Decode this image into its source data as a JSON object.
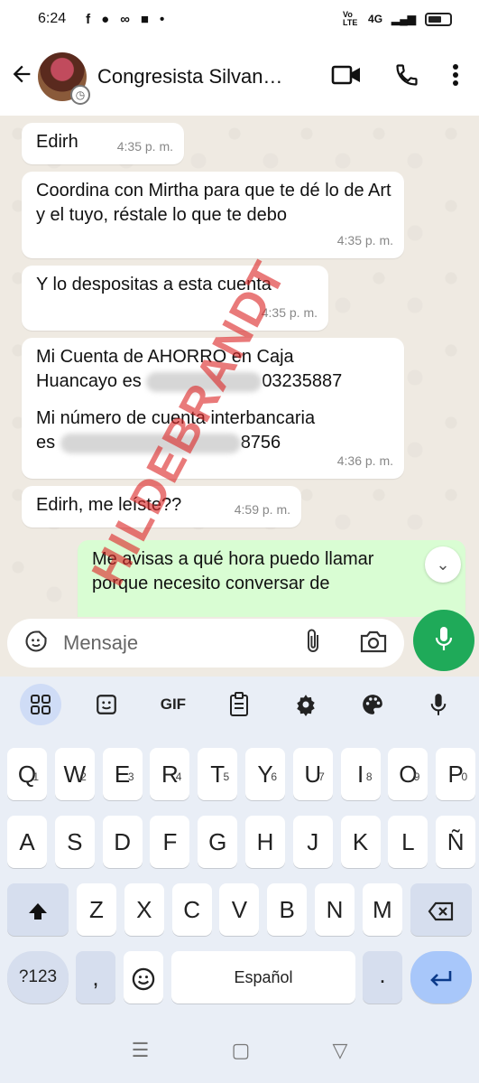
{
  "status_bar": {
    "time": "6:24",
    "network": "4G",
    "volte": "Vo LTE"
  },
  "header": {
    "contact_name": "Congresista Silvan…"
  },
  "messages": [
    {
      "text": "Edirh",
      "time": "4:35 p. m."
    },
    {
      "text": "Coordina con Mirtha para que te dé lo de Art y el tuyo, réstale lo que te debo",
      "time": "4:35 p. m."
    },
    {
      "text": "Y lo despositas a esta cuenta",
      "time": "4:35 p. m."
    },
    {
      "line1": "Mi Cuenta de AHORRO en Caja",
      "line2_start": "Huancayo es",
      "line2_end": "03235887",
      "line3": "Mi número de cuenta interbancaria",
      "line4_start": "es",
      "line4_end": "8756",
      "time": "4:36 p. m."
    },
    {
      "text": "Edirh, me leíste??",
      "time": "4:59 p. m."
    },
    {
      "line1": "Me avisas a qué hora puedo llamar",
      "line2": "porque necesito conversar de"
    }
  ],
  "composer": {
    "placeholder": "Mensaje"
  },
  "keyboard": {
    "toolbar": [
      "grid-icon",
      "sticker-icon",
      "GIF",
      "clipboard-icon",
      "settings-icon",
      "palette-icon",
      "mic-icon"
    ],
    "gif_label": "GIF",
    "row1": [
      "Q",
      "W",
      "E",
      "R",
      "T",
      "Y",
      "U",
      "I",
      "O",
      "P"
    ],
    "row1_hints": [
      "1",
      "2",
      "3",
      "4",
      "5",
      "6",
      "7",
      "8",
      "9",
      "0"
    ],
    "row2": [
      "A",
      "S",
      "D",
      "F",
      "G",
      "H",
      "J",
      "K",
      "L",
      "Ñ"
    ],
    "row3": [
      "Z",
      "X",
      "C",
      "V",
      "B",
      "N",
      "M"
    ],
    "numbers_key": "?123",
    "comma_key": ",",
    "space_label": "Español",
    "period_key": "."
  },
  "watermark": "HILDEBRANDT",
  "colors": {
    "accent": "#1faa59",
    "outgoing_bubble": "#d9fdd3",
    "chat_bg": "#efeae2",
    "watermark": "#dc2828"
  }
}
